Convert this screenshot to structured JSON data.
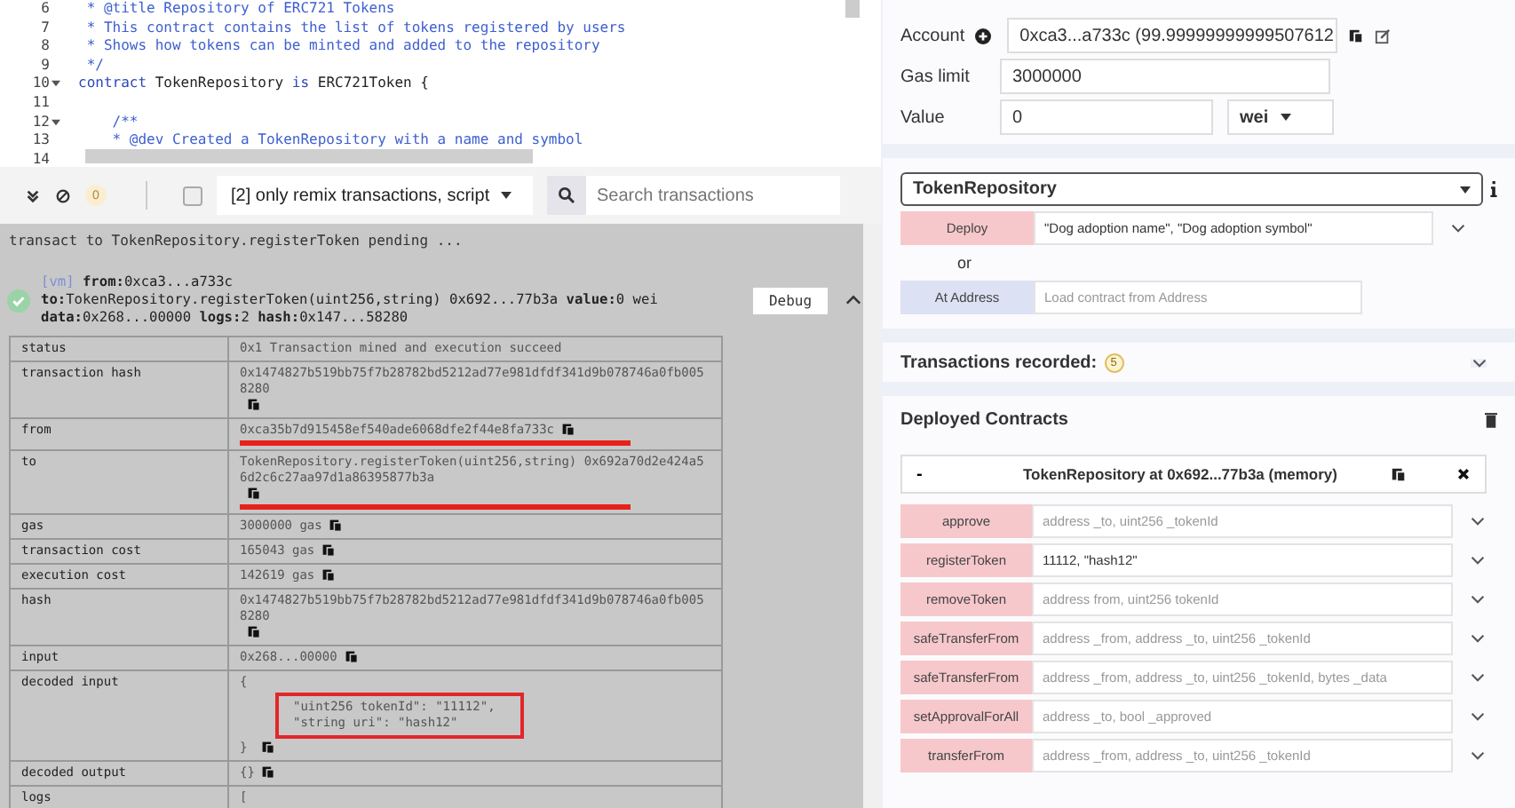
{
  "editor": {
    "lines": [
      {
        "number": "6",
        "foldable": false,
        "tokens": [
          {
            "text": " * @title Repository of ERC721 Tokens",
            "kind": "comment"
          }
        ]
      },
      {
        "number": "7",
        "foldable": false,
        "tokens": [
          {
            "text": " * This contract contains the list of tokens registered by users",
            "kind": "comment"
          }
        ]
      },
      {
        "number": "8",
        "foldable": false,
        "tokens": [
          {
            "text": " * Shows how tokens can be minted and added to the repository",
            "kind": "comment"
          }
        ]
      },
      {
        "number": "9",
        "foldable": false,
        "tokens": [
          {
            "text": " */",
            "kind": "comment"
          }
        ]
      },
      {
        "number": "10",
        "foldable": true,
        "tokens": [
          {
            "text": "contract",
            "kind": "keyword"
          },
          {
            "text": " TokenRepository ",
            "kind": "plain"
          },
          {
            "text": "is",
            "kind": "keyword"
          },
          {
            "text": " ERC721Token {",
            "kind": "plain"
          }
        ]
      },
      {
        "number": "11",
        "foldable": false
      },
      {
        "number": "12",
        "foldable": true,
        "tokens": [
          {
            "text": "    /**",
            "kind": "comment"
          }
        ]
      },
      {
        "number": "13",
        "foldable": false,
        "tokens": [
          {
            "text": "    * @dev Created a TokenRepository with a name and symbol",
            "kind": "comment"
          }
        ]
      },
      {
        "number": "14",
        "foldable": false
      }
    ]
  },
  "terminal": {
    "pending_count": "0",
    "filter_checked": false,
    "filter": "[2] only remix transactions, script",
    "search": {
      "placeholder": "Search transactions"
    },
    "pending": "transact to TokenRepository.registerToken pending ...",
    "tx": {
      "tag": "[vm]",
      "lines": [
        "**from:**0xca3...a733c",
        "**to:**TokenRepository.registerToken(uint256,string) 0x692...77b3a **value:**0 wei",
        "**data:**0x268...00000 **logs:**2 **hash:**0x147...58280"
      ],
      "debug": "Debug"
    },
    "table": [
      {
        "key": "status",
        "value": [
          "0x1 Transaction mined and execution succeed"
        ],
        "copy": false
      },
      {
        "key": "transaction hash",
        "value": [
          "0x1474827b519bb75f7b28782bd5212ad77e981dfdf341d9b078746a0fb0058280"
        ],
        "copy": true
      },
      {
        "key": "from",
        "value": [
          "0xca35b7d915458ef540ade6068dfe2f44e8fa733c"
        ],
        "copy": true,
        "underlined": true
      },
      {
        "key": "to",
        "value": [
          "TokenRepository.registerToken(uint256,string) 0x692a70d2e424a56d2c6c27aa97d1a86395877b3a"
        ],
        "copy": true,
        "underlined": true
      },
      {
        "key": "gas",
        "value": [
          "3000000 gas"
        ],
        "copy": true
      },
      {
        "key": "transaction cost",
        "value": [
          "165043 gas"
        ],
        "copy": true
      },
      {
        "key": "execution cost",
        "value": [
          "142619 gas"
        ],
        "copy": true
      },
      {
        "key": "hash",
        "value": [
          "0x1474827b519bb75f7b28782bd5212ad77e981dfdf341d9b078746a0fb0058280"
        ],
        "copy": true
      },
      {
        "key": "input",
        "value": [
          "0x268...00000"
        ],
        "copy": true
      },
      {
        "key": "decoded input",
        "open": "{",
        "value": [
          "\"uint256 tokenId\": \"11112\",",
          "\"string uri\": \"hash12\""
        ],
        "close": "}",
        "copy": true,
        "boxed": true
      },
      {
        "key": "decoded output",
        "value": [
          "{}"
        ],
        "copy": true
      },
      {
        "key": "logs",
        "value": [
          "["
        ],
        "copy": false
      }
    ]
  },
  "run": {
    "account": {
      "label": "Account",
      "value": "0xca3...a733c (99.99999999999507612"
    },
    "gas_limit": {
      "label": "Gas limit",
      "value": "3000000"
    },
    "value": {
      "label": "Value",
      "value": "0",
      "unit": "wei"
    },
    "contract": "TokenRepository",
    "deploy": {
      "label": "Deploy",
      "value": "\"Dog adoption name\", \"Dog adoption symbol\""
    },
    "or": "or",
    "at_address": {
      "label": "At Address",
      "placeholder": "Load contract from Address"
    },
    "recorded": {
      "label": "Transactions recorded:",
      "count": "5"
    },
    "deployed": {
      "title": "Deployed Contracts",
      "instance": {
        "toggle": "-",
        "title": "TokenRepository at 0x692...77b3a (memory)"
      },
      "functions": [
        {
          "name": "approve",
          "placeholder": "address _to, uint256 _tokenId"
        },
        {
          "name": "registerToken",
          "value": "11112, \"hash12\""
        },
        {
          "name": "removeToken",
          "placeholder": "address from, uint256 tokenId"
        },
        {
          "name": "safeTransferFrom",
          "placeholder": "address _from, address _to, uint256 _tokenId"
        },
        {
          "name": "safeTransferFrom",
          "placeholder": "address _from, address _to, uint256 _tokenId, bytes _data"
        },
        {
          "name": "setApprovalForAll",
          "placeholder": "address _to, bool _approved"
        },
        {
          "name": "transferFrom",
          "placeholder": "address _from, address _to, uint256 _tokenId"
        }
      ]
    }
  }
}
